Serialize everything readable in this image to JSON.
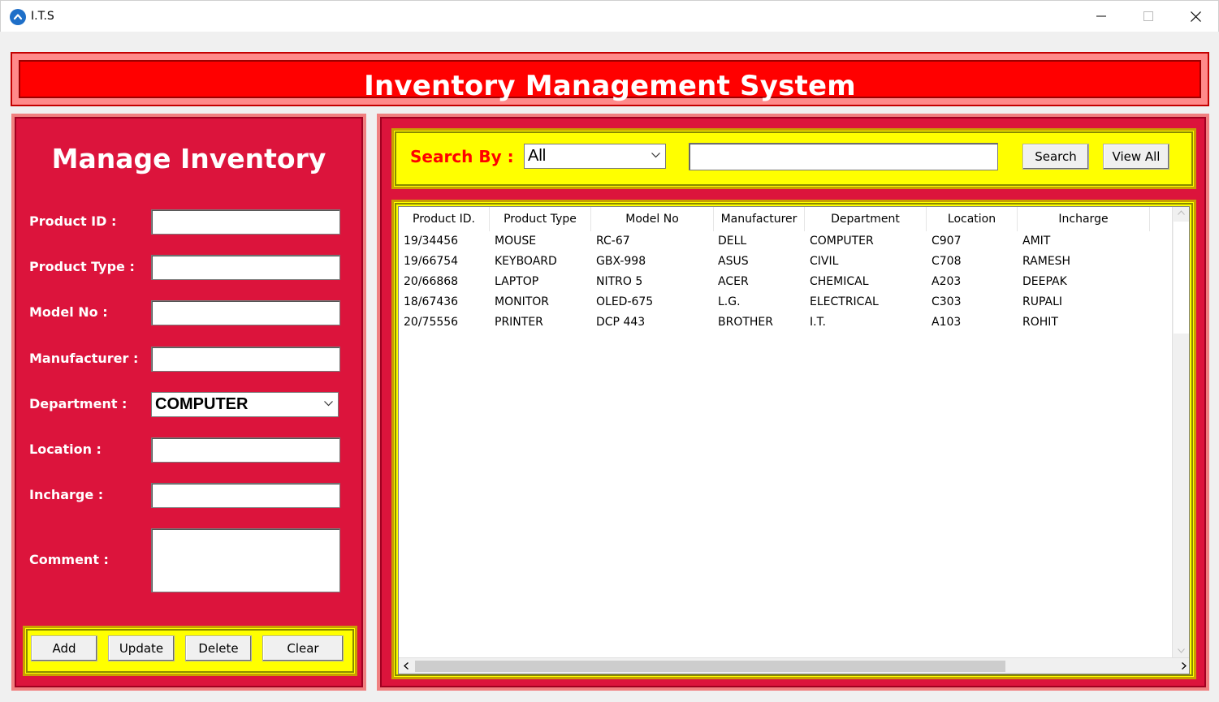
{
  "window": {
    "title": "I.T.S"
  },
  "header": {
    "title": "Inventory Management System"
  },
  "manage": {
    "title": "Manage Inventory",
    "fields": {
      "product_id": {
        "label": "Product ID :",
        "value": ""
      },
      "product_type": {
        "label": "Product Type :",
        "value": ""
      },
      "model_no": {
        "label": "Model No :",
        "value": ""
      },
      "manufacturer": {
        "label": "Manufacturer :",
        "value": ""
      },
      "department": {
        "label": "Department :",
        "value": "COMPUTER"
      },
      "location": {
        "label": "Location :",
        "value": ""
      },
      "incharge": {
        "label": "Incharge :",
        "value": ""
      },
      "comment": {
        "label": "Comment :",
        "value": ""
      }
    },
    "buttons": {
      "add": "Add",
      "update": "Update",
      "delete": "Delete",
      "clear": "Clear"
    }
  },
  "search": {
    "label": "Search By :",
    "by": "All",
    "query": "",
    "search_button": "Search",
    "view_all_button": "View All"
  },
  "table": {
    "columns": [
      "Product ID.",
      "Product Type",
      "Model No",
      "Manufacturer",
      "Department",
      "Location",
      "Incharge"
    ],
    "rows": [
      [
        "19/34456",
        "MOUSE",
        "RC-67",
        "DELL",
        "COMPUTER",
        "C907",
        "AMIT"
      ],
      [
        "19/66754",
        "KEYBOARD",
        "GBX-998",
        "ASUS",
        "CIVIL",
        "C708",
        "RAMESH"
      ],
      [
        "20/66868",
        "LAPTOP",
        "NITRO 5",
        "ACER",
        "CHEMICAL",
        "A203",
        "DEEPAK"
      ],
      [
        "18/67436",
        "MONITOR",
        "OLED-675",
        "L.G.",
        "ELECTRICAL",
        "C303",
        "RUPALI"
      ],
      [
        "20/75556",
        "PRINTER",
        "DCP 443",
        "BROTHER",
        "I.T.",
        "A103",
        "ROHIT"
      ]
    ]
  },
  "icons": {
    "app": "app-logo-icon",
    "minimize": "minimize-icon",
    "maximize": "maximize-icon",
    "close": "close-icon",
    "dropdown": "chevron-down-icon"
  },
  "colors": {
    "panel": "#dc143c",
    "header": "#ff0000",
    "frame": "#ffff00",
    "search_label": "#ff0000"
  }
}
